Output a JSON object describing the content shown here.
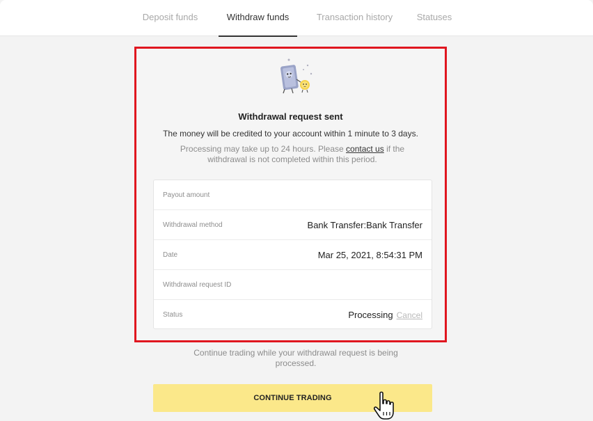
{
  "tabs": [
    {
      "label": "Deposit funds",
      "active": false
    },
    {
      "label": "Withdraw funds",
      "active": true
    },
    {
      "label": "Transaction history",
      "active": false
    },
    {
      "label": "Statuses",
      "active": false
    }
  ],
  "illustration": {
    "icon": "banknote-and-coin-mascot-icon"
  },
  "title": "Withdrawal request sent",
  "subtitle": "The money will be credited to your account within 1 minute to 3 days.",
  "note": {
    "before": "Processing may take up to 24 hours. Please ",
    "link": "contact us",
    "after": " if the withdrawal is not completed within this period."
  },
  "details": {
    "payout_amount": {
      "label": "Payout amount",
      "value": ""
    },
    "withdrawal_method": {
      "label": "Withdrawal method",
      "value": "Bank Transfer:Bank Transfer"
    },
    "date": {
      "label": "Date",
      "value": "Mar 25, 2021, 8:54:31 PM"
    },
    "request_id": {
      "label": "Withdrawal request ID",
      "value": ""
    },
    "status": {
      "label": "Status",
      "value": "Processing",
      "action": "Cancel"
    }
  },
  "continue_text": "Continue trading while your withdrawal request is being processed.",
  "cta_label": "CONTINUE TRADING",
  "colors": {
    "highlight": "#e0161f",
    "cta": "#fbe88a"
  }
}
